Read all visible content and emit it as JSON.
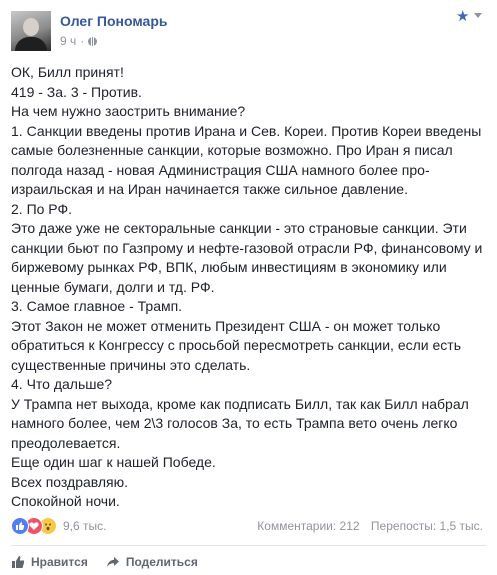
{
  "post": {
    "author": "Олег Пономарь",
    "time": "9 ч",
    "paragraphs": [
      "ОК, Билл принят!",
      "419 - За. 3 - Против.",
      "На чем нужно заострить внимание?",
      "1. Санкции введены против Ирана и Сев. Кореи. Против Кореи введены самые болезненные санкции, которые возможно. Про Иран я писал полгода назад - новая Администрация США намного более про-израильская и на Иран начинается также сильное давление.",
      "2. По РФ.",
      "Это даже уже не секторальные санкции - это страновые санкции. Эти санкции бьют по Газпрому и нефте-газовой отрасли РФ, финансовому и биржевому рынках РФ, ВПК, любым инвестициям в экономику или ценные бумаги, долги и тд. РФ.",
      "3. Самое главное - Трамп.",
      "Этот Закон не может отменить Президент США - он может только обратиться к Конгрессу с просьбой пересмотреть санкции, если есть существенные причины это сделать.",
      "4. Что дальше?",
      "У Трампа нет выхода, кроме как подписать Билл, так как Билл набрал намного более, чем 2\\3 голосов За, то есть Трампа вето очень легко преодолевается.",
      "Еще один шаг к нашей Победе.",
      "Всех поздравляю.",
      "Спокойной ночи."
    ]
  },
  "reactions": {
    "icons": [
      "like-icon",
      "love-icon",
      "wow-icon"
    ],
    "count": "9,6 тыс."
  },
  "stats": {
    "comments": "Комментарии: 212",
    "shares": "Перепосты: 1,5 тыс."
  },
  "actions": {
    "like": "Нравится",
    "share": "Поделиться"
  },
  "colors": {
    "name": "#365899",
    "meta": "#90949c",
    "like": "#4f7ff1",
    "love": "#f25268",
    "wow": "#f7c94b"
  }
}
